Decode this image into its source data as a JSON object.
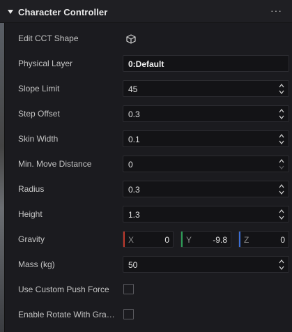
{
  "component": {
    "title": "Character Controller",
    "more_label": "···"
  },
  "rows": {
    "edit_shape": {
      "label": "Edit CCT Shape",
      "icon": "cube-icon"
    },
    "physical_layer": {
      "label": "Physical Layer",
      "value": "0:Default"
    },
    "slope_limit": {
      "label": "Slope Limit",
      "value": "45"
    },
    "step_offset": {
      "label": "Step Offset",
      "value": "0.3"
    },
    "skin_width": {
      "label": "Skin Width",
      "value": "0.1"
    },
    "min_move_distance": {
      "label": "Min. Move Distance",
      "value": "0"
    },
    "radius": {
      "label": "Radius",
      "value": "0.3"
    },
    "height": {
      "label": "Height",
      "value": "1.3"
    },
    "gravity": {
      "label": "Gravity",
      "x": {
        "axis": "X",
        "value": "0"
      },
      "y": {
        "axis": "Y",
        "value": "-9.8"
      },
      "z": {
        "axis": "Z",
        "value": "0"
      }
    },
    "mass": {
      "label": "Mass (kg)",
      "value": "50"
    },
    "custom_push_force": {
      "label": "Use Custom Push Force",
      "checked": false
    },
    "rotate_with_gravity": {
      "label": "Enable Rotate With Gra…",
      "checked": false
    }
  },
  "colors": {
    "axis_x": "#c0392b",
    "axis_y": "#2e9e57",
    "axis_z": "#3b6fd6"
  }
}
